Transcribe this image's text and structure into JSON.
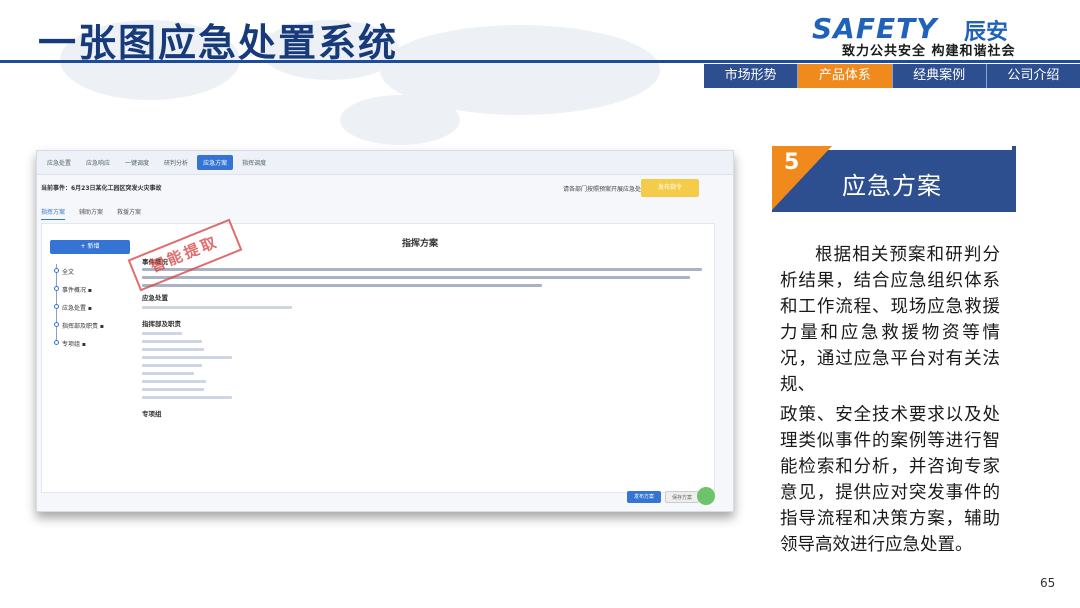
{
  "header": {
    "title": "一张图应急处置系统",
    "logo_mark": "SAFETY",
    "logo_cn": "辰安",
    "logo_slogan": "致力公共安全 构建和谐社会"
  },
  "nav": {
    "tabs": [
      {
        "label": "市场形势"
      },
      {
        "label": "产品体系",
        "active": true
      },
      {
        "label": "经典案例"
      },
      {
        "label": "公司介绍"
      }
    ]
  },
  "screenshot": {
    "tabs": [
      "应急处置",
      "应急响应",
      "一键调度",
      "研判分析",
      "应急方案",
      "指挥调度"
    ],
    "event": "当前事件：6月23日某化工园区突发火灾事故",
    "dept": "请各部门按照预案开展应急处置",
    "yellow_button": "发布指令",
    "subtabs": [
      "指挥方案",
      "辅助方案",
      "救援方案"
    ],
    "side_button": "+ 新增",
    "tree": [
      "全文",
      "事件概况 ▪",
      "应急处置 ▪",
      "指挥部及职责 ▪",
      "专项组 ▪"
    ],
    "doc_title": "指挥方案",
    "stamp": "智能提取",
    "headings": [
      "事件概况",
      "应急处置",
      "指挥部及职责",
      "专项组"
    ],
    "bottom_btn1": "发布方案",
    "bottom_btn2": "保存方案"
  },
  "section": {
    "number": "5",
    "title": "应急方案",
    "paragraphs": [
      "根据相关预案和研判分析结果，结合应急组织体系和工作流程、现场应急救援力量和应急救援物资等情况，通过应急平台对有关法规、",
      "政策、安全技术要求以及处理类似事件的案例等进行智能检索和分析，并咨询专家意见，提供应对突发事件的指导流程和决策方案，辅助领导高效进行应急处置。"
    ]
  },
  "page_number": "65",
  "colors": {
    "primary": "#2d4f8f",
    "accent": "#f08a1c",
    "title": "#163a7a"
  }
}
